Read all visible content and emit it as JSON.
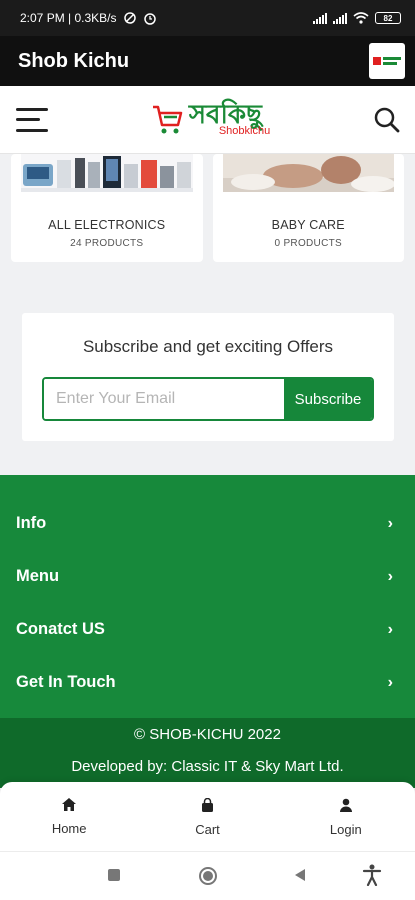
{
  "status_bar": {
    "left_text": "2:07 PM | 0.3KB/s",
    "battery": "82"
  },
  "app_bar": {
    "title": "Shob Kichu",
    "logo_text": "সব"
  },
  "header": {
    "logo_bn": "সবকিছু",
    "logo_en": "Shobkichu"
  },
  "categories": [
    {
      "title": "ALL ELECTRONICS",
      "count": "24 PRODUCTS"
    },
    {
      "title": "BABY CARE",
      "count": "0 PRODUCTS"
    }
  ],
  "subscribe": {
    "title": "Subscribe and get exciting Offers",
    "placeholder": "Enter Your Email",
    "button": "Subscribe"
  },
  "footer": {
    "items": [
      {
        "label": "Info"
      },
      {
        "label": "Menu"
      },
      {
        "label": "Conatct US"
      },
      {
        "label": "Get In Touch"
      }
    ],
    "copyright": "© SHOB-KICHU 2022",
    "developer": "Developed by: Classic IT & Sky Mart Ltd."
  },
  "bottom_nav": [
    {
      "label": "Home",
      "icon": "home-icon"
    },
    {
      "label": "Cart",
      "icon": "bag-icon"
    },
    {
      "label": "Login",
      "icon": "user-icon"
    }
  ],
  "colors": {
    "brand_green": "#17893b",
    "dark_green": "#0f6a2a",
    "accent_red": "#e02020"
  }
}
